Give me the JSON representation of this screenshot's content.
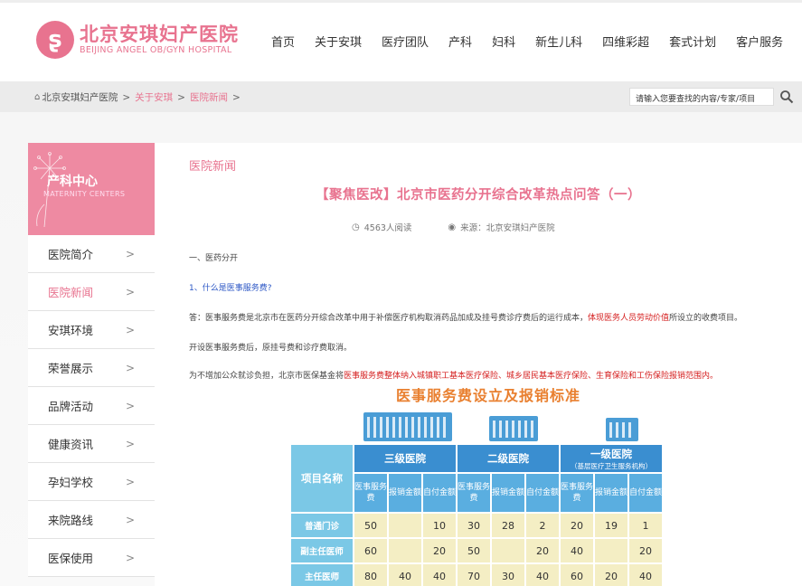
{
  "header": {
    "logo_cn": "北京安琪妇产医院",
    "logo_en": "BEIJING ANGEL OB/GYN HOSPITAL",
    "nav": [
      "首页",
      "关于安琪",
      "医疗团队",
      "产科",
      "妇科",
      "新生儿科",
      "四维彩超",
      "套式计划",
      "客户服务"
    ]
  },
  "breadcrumb": {
    "home": "北京安琪妇产医院",
    "sep": ">",
    "level1": "关于安琪",
    "level2": "医院新闻"
  },
  "search": {
    "placeholder": "请输入您要查找的内容/专家/项目"
  },
  "sidebar": {
    "title": "产科中心",
    "subtitle": "MATERNITY CENTERS",
    "arrow": ">",
    "items": [
      {
        "label": "医院简介"
      },
      {
        "label": "医院新闻"
      },
      {
        "label": "安琪环境"
      },
      {
        "label": "荣誉展示"
      },
      {
        "label": "品牌活动"
      },
      {
        "label": "健康资讯"
      },
      {
        "label": "孕妇学校"
      },
      {
        "label": "来院路线"
      },
      {
        "label": "医保使用"
      }
    ]
  },
  "article": {
    "section": "医院新闻",
    "title": "【聚焦医改】北京市医药分开综合改革热点问答（一）",
    "views": "4563人阅读",
    "source": "来源：北京安琪妇产医院",
    "p1": "一、医药分开",
    "p2": "1、什么是医事服务费?",
    "p3_a": "答：医事服务费是北京市在医药分开综合改革中用于补偿医疗机构取消药品加成及挂号费诊疗费后的运行成本，",
    "p3_red": "体现医务人员劳动价值",
    "p3_b": "所设立的收费项目。",
    "p4": "开设医事服务费后，原挂号费和诊疗费取消。",
    "p5_a": "为不增加公众就诊负担，北京市医保基金将",
    "p5_red": "医事服务费整体纳入城镇职工基本医疗保险、城乡居民基本医疗保险、生育保险和工伤保险报销范围内。"
  },
  "infographic": {
    "title": "医事服务费设立及报销标准",
    "col_name": "项目名称",
    "levels": [
      {
        "name": "三级医院",
        "note": ""
      },
      {
        "name": "二级医院",
        "note": ""
      },
      {
        "name": "一级医院",
        "note": "（基层医疗卫生服务机构）"
      }
    ],
    "sub_headers": [
      "医事服务费",
      "报销金额",
      "自付金额"
    ],
    "rows": [
      {
        "name": "普通门诊",
        "values": [
          "50",
          "",
          "10",
          "30",
          "28",
          "2",
          "20",
          "19",
          "1"
        ]
      },
      {
        "name": "副主任医师",
        "values": [
          "60",
          "",
          "20",
          "50",
          "",
          "20",
          "40",
          "",
          "20"
        ]
      },
      {
        "name": "主任医师",
        "values": [
          "80",
          "40",
          "40",
          "70",
          "30",
          "40",
          "60",
          "20",
          "40"
        ]
      }
    ]
  },
  "colors": {
    "brand": "#e8738f",
    "accent_red": "#d52020",
    "link_blue": "#2b56c5"
  }
}
